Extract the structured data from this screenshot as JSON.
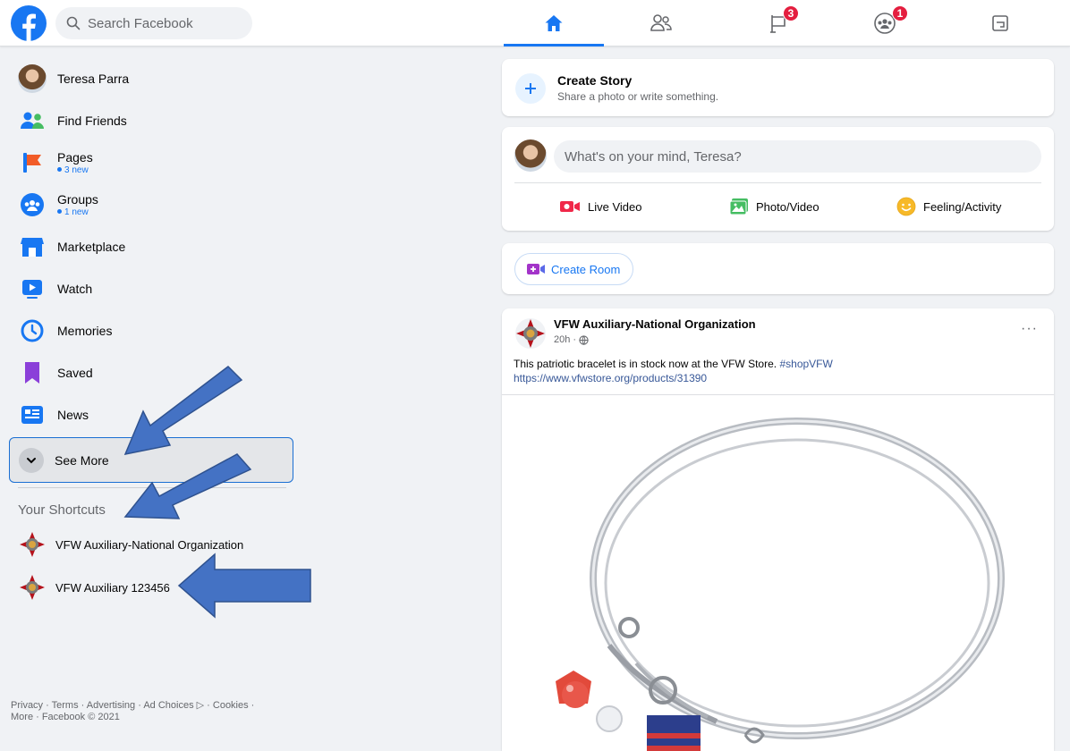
{
  "topbar": {
    "search_placeholder": "Search Facebook",
    "tabs": [
      {
        "icon": "home-icon",
        "active": true
      },
      {
        "icon": "friends-icon"
      },
      {
        "icon": "pages-flag-icon",
        "badge": "3"
      },
      {
        "icon": "groups-icon",
        "badge": "1"
      },
      {
        "icon": "gaming-icon"
      }
    ]
  },
  "sidebar": {
    "items": [
      {
        "label": "Teresa Parra"
      },
      {
        "label": "Find Friends"
      },
      {
        "label": "Pages",
        "sub": "3 new"
      },
      {
        "label": "Groups",
        "sub": "1 new"
      },
      {
        "label": "Marketplace"
      },
      {
        "label": "Watch"
      },
      {
        "label": "Memories"
      },
      {
        "label": "Saved"
      },
      {
        "label": "News"
      }
    ],
    "see_more": "See More",
    "shortcuts_title": "Your Shortcuts",
    "shortcuts": [
      "VFW Auxiliary-National Organization",
      "VFW Auxiliary 123456"
    ],
    "footer_line1": "Privacy · Terms · Advertising · Ad Choices ▷ · Cookies ·",
    "footer_line2": "More · Facebook © 2021"
  },
  "story": {
    "title": "Create Story",
    "subtitle": "Share a photo or write something."
  },
  "composer": {
    "placeholder": "What's on your mind, Teresa?",
    "live": "Live Video",
    "photo": "Photo/Video",
    "feeling": "Feeling/Activity"
  },
  "room": {
    "label": "Create Room"
  },
  "post": {
    "author": "VFW Auxiliary-National Organization",
    "time": "20h ·",
    "more": "···",
    "text": "This patriotic bracelet is in stock now at the VFW Store.",
    "hashtag": "#shopVFW",
    "link": "https://www.vfwstore.org/products/31390"
  },
  "colors": {
    "brand": "#1877f2",
    "badge": "#e41e3f",
    "arrow": "#4472c4"
  }
}
